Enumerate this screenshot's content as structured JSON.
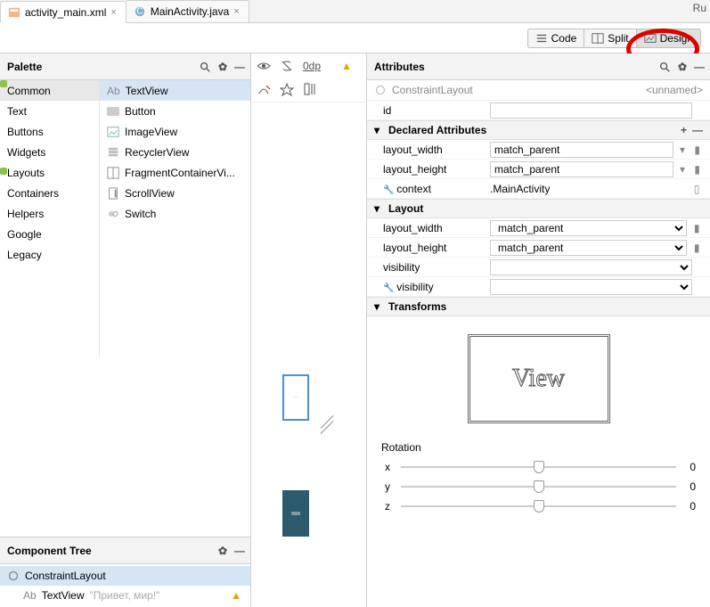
{
  "tabs": {
    "t0": {
      "label": "activity_main.xml",
      "selected": true
    },
    "t1": {
      "label": "MainActivity.java",
      "selected": false
    }
  },
  "top_right_cut": "Ru",
  "modes": {
    "code": "Code",
    "split": "Split",
    "design": "Design"
  },
  "palette": {
    "title": "Palette",
    "categories": [
      "Common",
      "Text",
      "Buttons",
      "Widgets",
      "Layouts",
      "Containers",
      "Helpers",
      "Google",
      "Legacy"
    ],
    "items": [
      "TextView",
      "Button",
      "ImageView",
      "RecyclerView",
      "FragmentContainerVi...",
      "ScrollView",
      "Switch"
    ]
  },
  "component_tree": {
    "title": "Component Tree",
    "root": "ConstraintLayout",
    "child": "TextView",
    "child_text": "\"Привет, мир!\""
  },
  "mid": {
    "zero_dp": "0dp"
  },
  "attributes": {
    "title": "Attributes",
    "root_type": "ConstraintLayout",
    "unnamed": "<unnamed>",
    "id_label": "id",
    "declared": "Declared Attributes",
    "layout": "Layout",
    "transforms": "Transforms",
    "layout_width_label": "layout_width",
    "layout_height_label": "layout_height",
    "context_label": "context",
    "visibility_label": "visibility",
    "tools_visibility_label": "visibility",
    "layout_width": "match_parent",
    "layout_height": "match_parent",
    "context": ".MainActivity",
    "view_text": "View",
    "rotation_label": "Rotation",
    "axes": {
      "x": "x",
      "y": "y",
      "z": "z"
    },
    "zero": "0"
  }
}
